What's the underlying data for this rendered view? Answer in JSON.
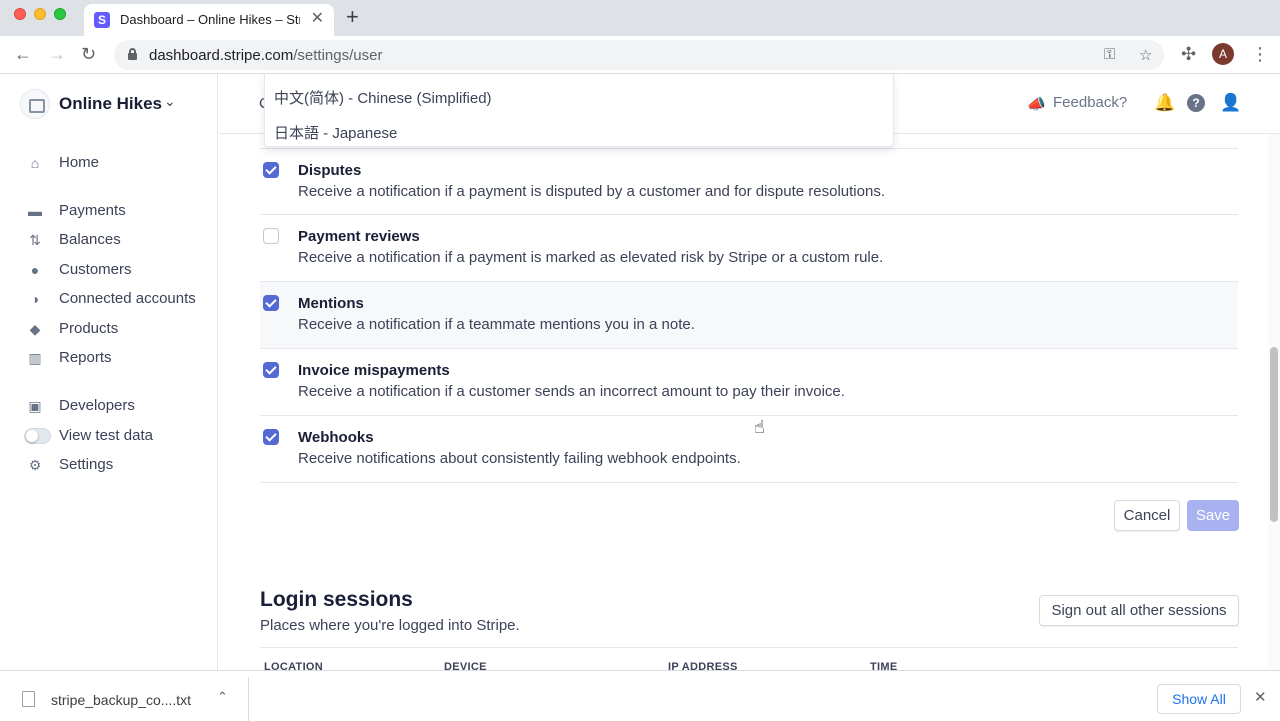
{
  "browser": {
    "tab_title": "Dashboard – Online Hikes – Stripe",
    "tab_favicon": "S",
    "url_host": "dashboard.stripe.com",
    "url_path": "/settings/user",
    "profile_initial": "A"
  },
  "sidebar": {
    "account_name": "Online Hikes",
    "items": [
      {
        "label": "Home",
        "icon": "home-icon"
      },
      {
        "label": "Payments",
        "icon": "payments-icon"
      },
      {
        "label": "Balances",
        "icon": "balances-icon"
      },
      {
        "label": "Customers",
        "icon": "customers-icon"
      },
      {
        "label": "Connected accounts",
        "icon": "connected-accounts-icon"
      },
      {
        "label": "Products",
        "icon": "products-icon"
      },
      {
        "label": "Reports",
        "icon": "reports-icon"
      },
      {
        "label": "Developers",
        "icon": "developers-icon"
      },
      {
        "label": "View test data",
        "icon": "toggle"
      },
      {
        "label": "Settings",
        "icon": "gear-icon"
      }
    ]
  },
  "header": {
    "feedback_label": "Feedback?"
  },
  "dropdown": {
    "options": [
      "中文(简体) - Chinese (Simplified)",
      "日本語 - Japanese"
    ]
  },
  "notifications": [
    {
      "title": "Disputes",
      "description": "Receive a notification if a payment is disputed by a customer and for dispute resolutions.",
      "checked": true
    },
    {
      "title": "Payment reviews",
      "description": "Receive a notification if a payment is marked as elevated risk by Stripe or a custom rule.",
      "checked": false
    },
    {
      "title": "Mentions",
      "description": "Receive a notification if a teammate mentions you in a note.",
      "checked": true
    },
    {
      "title": "Invoice mispayments",
      "description": "Receive a notification if a customer sends an incorrect amount to pay their invoice.",
      "checked": true
    },
    {
      "title": "Webhooks",
      "description": "Receive notifications about consistently failing webhook endpoints.",
      "checked": true
    }
  ],
  "actions": {
    "cancel_label": "Cancel",
    "save_label": "Save"
  },
  "login_sessions": {
    "title": "Login sessions",
    "subtitle": "Places where you're logged into Stripe.",
    "signout_label": "Sign out all other sessions",
    "columns": [
      "LOCATION",
      "DEVICE",
      "IP ADDRESS",
      "TIME"
    ]
  },
  "download_shelf": {
    "file_name": "stripe_backup_co....txt",
    "show_all_label": "Show All"
  },
  "colors": {
    "accent": "#5469d4",
    "save_disabled": "#a8b2f0",
    "link": "#1a73e8"
  }
}
